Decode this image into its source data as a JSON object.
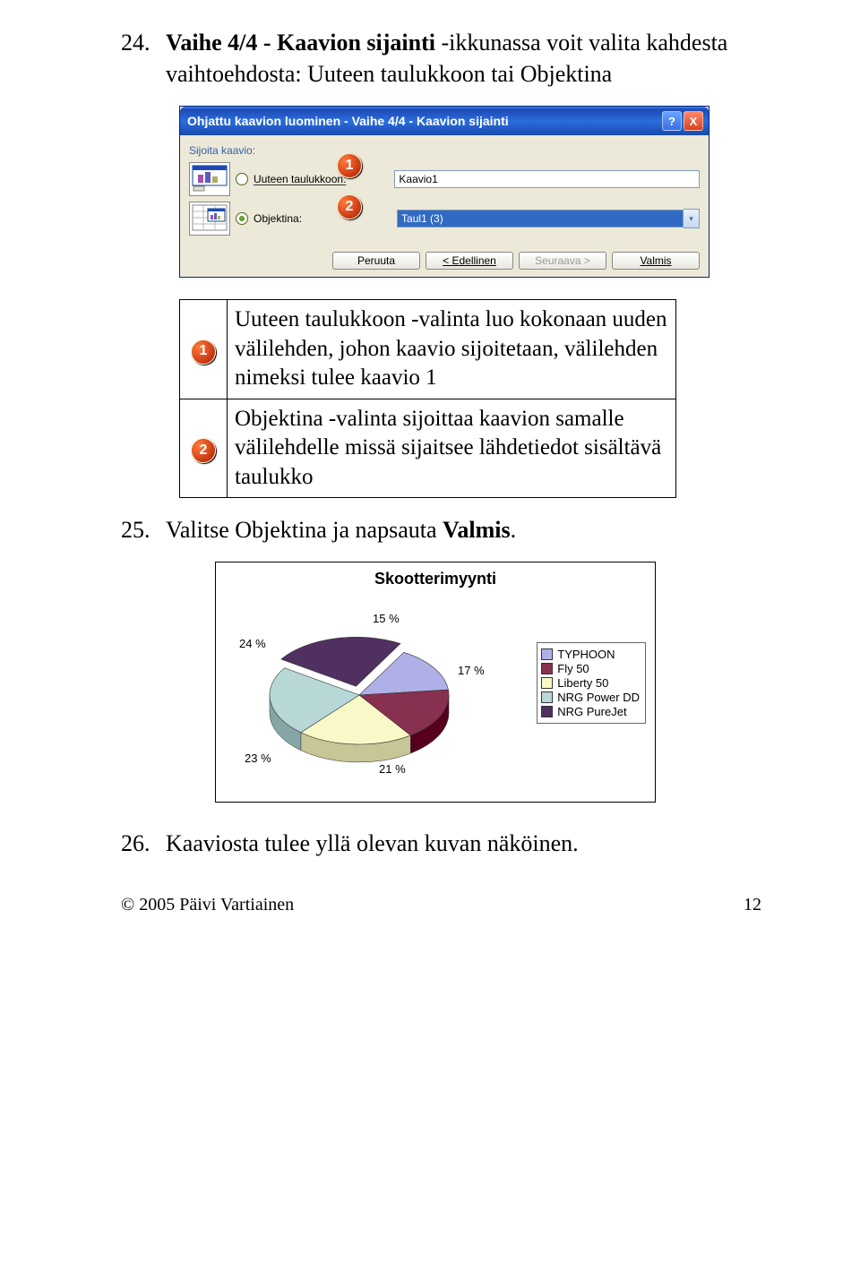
{
  "steps": {
    "s24": {
      "num": "24.",
      "prefix": "Vaihe 4/4 - Kaavion sijainti",
      "rest": " -ikkunassa voit valita kahdesta vaihtoehdosta: Uuteen taulukkoon tai Objektina"
    },
    "s25": {
      "num": "25.",
      "text_a": "Valitse Objektina ja napsauta ",
      "text_b": "Valmis",
      "text_c": "."
    },
    "s26": {
      "num": "26.",
      "text": "Kaaviosta tulee yllä olevan kuvan näköinen."
    }
  },
  "dialog": {
    "title": "Ohjattu kaavion luominen - Vaihe 4/4 - Kaavion sijainti",
    "place_label": "Sijoita kaavio:",
    "opt1_label": "Uuteen taulukkoon:",
    "opt1_value": "Kaavio1",
    "opt2_label": "Objektina:",
    "opt2_value": "Taul1 (3)",
    "btn_cancel": "Peruuta",
    "btn_back": "< Edellinen",
    "btn_next": "Seuraava >",
    "btn_finish": "Valmis",
    "badge1": "1",
    "badge2": "2",
    "help": "?",
    "close": "X"
  },
  "table": {
    "b1": "1",
    "b2": "2",
    "row1": "Uuteen taulukkoon -valinta luo kokonaan uuden välilehden, johon kaavio sijoitetaan, välilehden nimeksi tulee kaavio 1",
    "row2": "Objektina -valinta sijoittaa kaavion samalle välilehdelle missä sijaitsee lähdetiedot sisältävä taulukko"
  },
  "chart_data": {
    "type": "pie",
    "title": "Skootterimyynti",
    "series": [
      {
        "name": "TYPHOON",
        "value": 15,
        "color": "#b0b0e8"
      },
      {
        "name": "Fly 50",
        "value": 17,
        "color": "#883050"
      },
      {
        "name": "Liberty 50",
        "value": 21,
        "color": "#f8f8c8"
      },
      {
        "name": "NRG Power DD",
        "value": 23,
        "color": "#b8d8d8"
      },
      {
        "name": "NRG PureJet",
        "value": 24,
        "color": "#503060"
      }
    ],
    "labels": {
      "l15": "15 %",
      "l17": "17 %",
      "l21": "21 %",
      "l23": "23 %",
      "l24": "24 %"
    }
  },
  "footer": {
    "left": "© 2005 Päivi Vartiainen",
    "right": "12"
  }
}
